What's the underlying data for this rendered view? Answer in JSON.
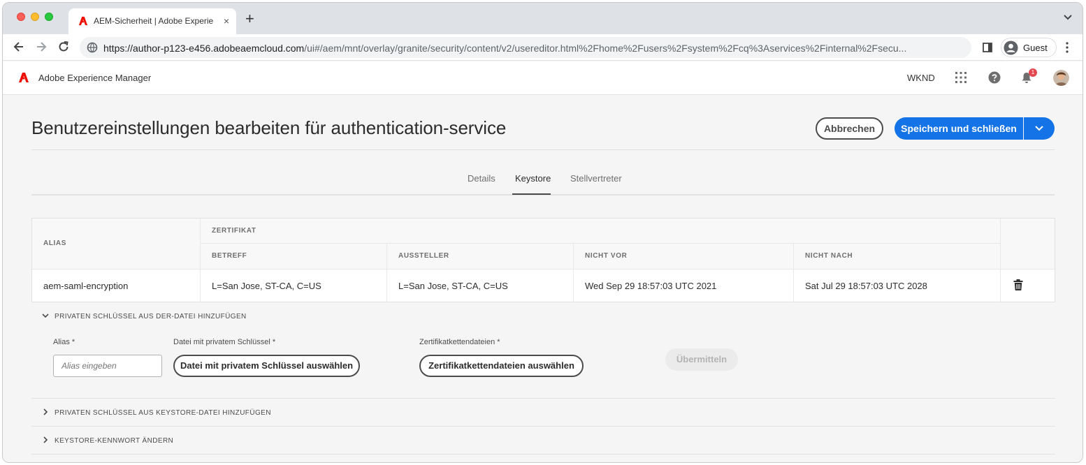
{
  "browser": {
    "tab_title": "AEM-Sicherheit | Adobe Experience Manager",
    "tab_close": "×",
    "new_tab": "+",
    "url_host": "https://author-p123-e456.adobeaemcloud.com",
    "url_path": "/ui#/aem/mnt/overlay/granite/security/content/v2/usereditor.html%2Fhome%2Fusers%2Fsystem%2Fcq%3Aservices%2Finternal%2Fsecu...",
    "profile_label": "Guest"
  },
  "aem_header": {
    "product_name": "Adobe Experience Manager",
    "org_name": "WKND",
    "notification_count": "1"
  },
  "page": {
    "title": "Benutzereinstellungen bearbeiten für authentication-service",
    "cancel_label": "Abbrechen",
    "save_label": "Speichern und schließen"
  },
  "tabs": [
    {
      "label": "Details",
      "active": false
    },
    {
      "label": "Keystore",
      "active": true
    },
    {
      "label": "Stellvertreter",
      "active": false
    }
  ],
  "table": {
    "headers": {
      "alias": "ALIAS",
      "certificate": "ZERTIFIKAT",
      "subject": "BETREFF",
      "issuer": "AUSSTELLER",
      "not_before": "NICHT VOR",
      "not_after": "NICHT NACH"
    },
    "rows": [
      {
        "alias": "aem-saml-encryption",
        "subject": "L=San Jose, ST-CA, C=US",
        "issuer": "L=San Jose, ST-CA, C=US",
        "not_before": "Wed Sep 29 18:57:03 UTC 2021",
        "not_after": "Sat Jul 29 18:57:03 UTC 2028"
      }
    ]
  },
  "accordion": {
    "der_section": {
      "title": "PRIVATEN SCHLÜSSEL AUS DER-DATEI HINZUFÜGEN",
      "expanded": true,
      "alias_label": "Alias *",
      "alias_placeholder": "Alias eingeben",
      "private_key_label": "Datei mit privatem Schlüssel *",
      "private_key_button": "Datei mit privatem Schlüssel auswählen",
      "cert_chain_label": "Zertifikatkettendateien *",
      "cert_chain_button": "Zertifikatkettendateien auswählen",
      "submit_label": "Übermitteln"
    },
    "keystore_section": {
      "title": "PRIVATEN SCHLÜSSEL AUS KEYSTORE-DATEI HINZUFÜGEN",
      "expanded": false
    },
    "password_section": {
      "title": "KEYSTORE-KENNWORT ÄNDERN",
      "expanded": false
    }
  },
  "colors": {
    "accent": "#1473e6",
    "adobe_red": "#eb1000",
    "badge": "#e34850"
  }
}
